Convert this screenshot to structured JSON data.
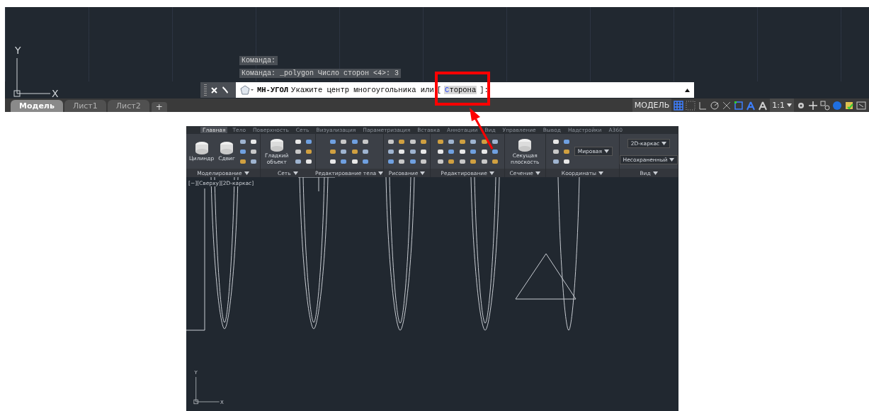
{
  "model_space": {
    "ucs": {
      "y_label": "Y",
      "x_label": "X"
    },
    "command_history": [
      "Команда:",
      "Команда: _polygon Число сторон <4>: 3"
    ],
    "command_line": {
      "command": "МН-УГОЛ",
      "prompt": "Укажите центр многоугольника или",
      "option_open": "[",
      "option": "Сторона",
      "option_close": "]:",
      "highlighted": true
    },
    "layout_tabs": [
      {
        "label": "Модель",
        "selected": true
      },
      {
        "label": "Лист1",
        "selected": false
      },
      {
        "label": "Лист2",
        "selected": false
      }
    ],
    "add_tab": "+",
    "status_bar": {
      "model_label": "МОДЕЛЬ",
      "scale": "1:1"
    }
  },
  "ribbon_window": {
    "tabs": [
      {
        "label": "Главная",
        "selected": true
      },
      {
        "label": "Тело",
        "selected": false
      },
      {
        "label": "Поверхность",
        "selected": false
      },
      {
        "label": "Сеть",
        "selected": false
      },
      {
        "label": "Визуализация",
        "selected": false
      },
      {
        "label": "Параметризация",
        "selected": false
      },
      {
        "label": "Вставка",
        "selected": false
      },
      {
        "label": "Аннотации",
        "selected": false
      },
      {
        "label": "Вид",
        "selected": false
      },
      {
        "label": "Управление",
        "selected": false
      },
      {
        "label": "Вывод",
        "selected": false
      },
      {
        "label": "Надстройки",
        "selected": false
      },
      {
        "label": "A360",
        "selected": false
      }
    ],
    "panels": [
      {
        "title": "Моделирование",
        "items": [
          {
            "kind": "large",
            "label": "Цилиндр"
          },
          {
            "kind": "large",
            "label": "Сдвиг"
          },
          {
            "kind": "tools"
          }
        ]
      },
      {
        "title": "Сеть",
        "items": [
          {
            "kind": "large",
            "label": "Гладкий объект"
          },
          {
            "kind": "tools"
          }
        ]
      },
      {
        "title": "Редактирование тела",
        "items": [
          {
            "kind": "tools"
          },
          {
            "kind": "tools"
          }
        ]
      },
      {
        "title": "Рисование",
        "items": [
          {
            "kind": "tools"
          },
          {
            "kind": "tools"
          }
        ]
      },
      {
        "title": "Редактирование",
        "items": [
          {
            "kind": "tools"
          },
          {
            "kind": "tools"
          },
          {
            "kind": "tools"
          }
        ]
      },
      {
        "title": "Сечение",
        "items": [
          {
            "kind": "large",
            "label": "Секущая плоскость"
          }
        ]
      },
      {
        "title": "Координаты",
        "items": [
          {
            "kind": "tools"
          },
          {
            "kind": "combo",
            "label": "Мировая"
          }
        ]
      },
      {
        "title": "Вид",
        "items": [
          {
            "kind": "combo",
            "label": "2D-каркас"
          },
          {
            "kind": "combo",
            "label": "Несохраненный"
          }
        ]
      }
    ],
    "viewport_label": "[−][Сверху][2D-каркас]",
    "ucs": {
      "y_label": "Y",
      "x_label": "X"
    }
  }
}
